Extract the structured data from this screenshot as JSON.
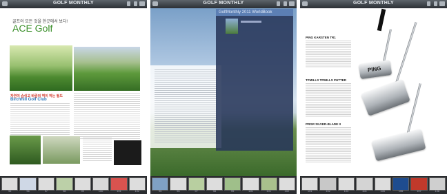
{
  "app_title": "GOLF MONTHLY",
  "page1": {
    "kicker": "골프의 모든 것을 한곳에서 보다!",
    "headline": "ACE Golf",
    "section_kicker": "자연이 숨쉬고 바람의 역이 하는 필드",
    "section_title": "Birchhill Golf Club"
  },
  "page2": {
    "popup_title": "GolfMonthly 2011 WorldBook"
  },
  "page3": {
    "sections": [
      {
        "title": "PING KARSTEN TR1"
      },
      {
        "title": "TPMILLS TPMILLS PUTTER"
      },
      {
        "title": "PRGR SILVER-BLADE II"
      }
    ],
    "putter_brand": "PING"
  },
  "strips": {
    "left": [
      "95",
      "96",
      "97",
      "98",
      "99",
      "100",
      "101",
      "102"
    ],
    "middle": [
      "95",
      "96",
      "97",
      "98",
      "99",
      "100",
      "101",
      "102"
    ],
    "right": [
      "101",
      "102",
      "103",
      "104",
      "105",
      "106",
      "107",
      "108"
    ]
  },
  "colors": {
    "accent_green": "#3a8f2a",
    "kicker_red": "#d23a2c",
    "title_blue": "#2a74b6",
    "bar_dark": "#2c3035"
  }
}
